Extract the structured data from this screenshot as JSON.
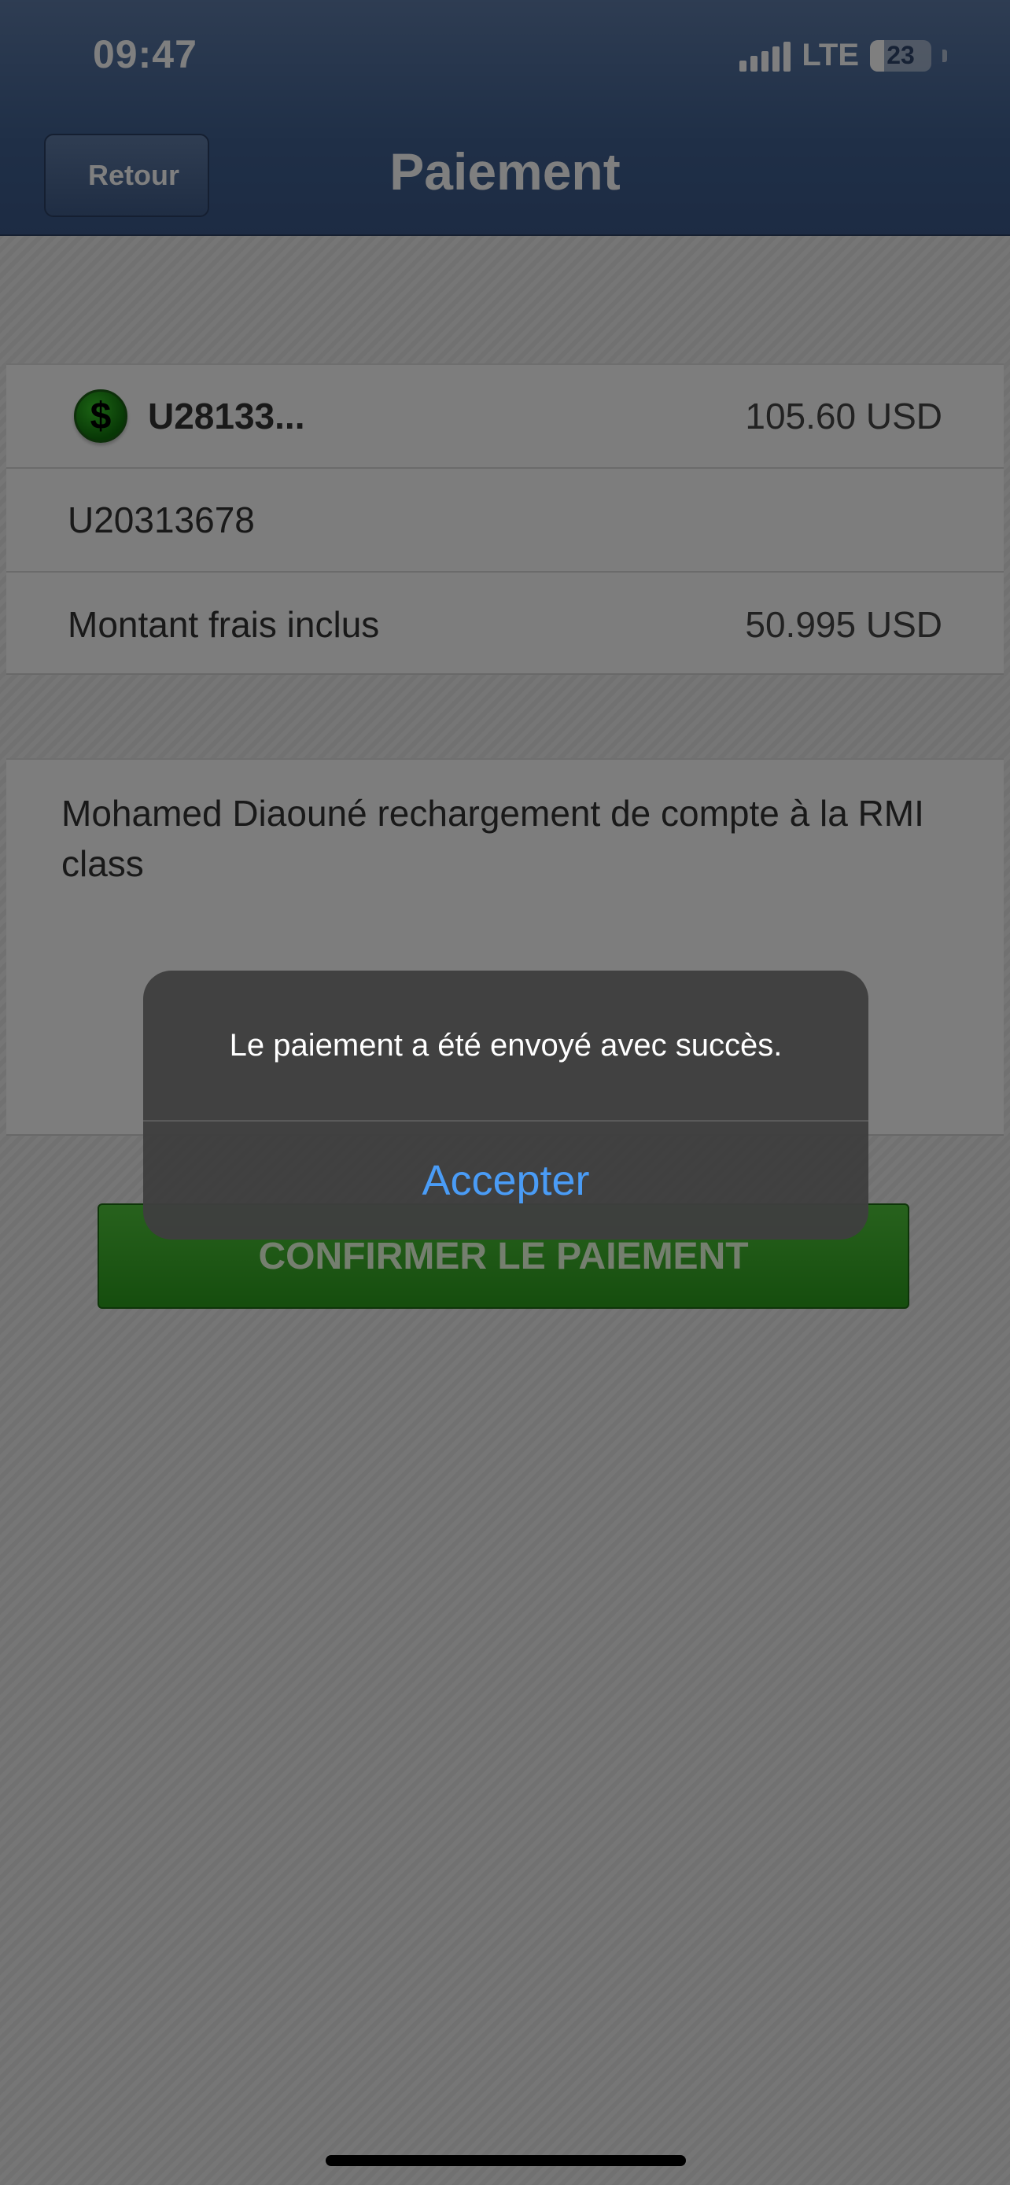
{
  "status_bar": {
    "time": "09:47",
    "network": "LTE",
    "battery_level": "23",
    "battery_fraction": 0.23
  },
  "nav": {
    "back_label": "Retour",
    "title": "Paiement"
  },
  "details": {
    "payer_account": "U28133...",
    "payer_balance": "105.60 USD",
    "payee_account": "U20313678",
    "amount_label": "Montant frais inclus",
    "amount_value": "50.995 USD"
  },
  "memo": "Mohamed Diaouné rechargement de compte à la RMI class",
  "confirm_button": "CONFIRMER LE PAIEMENT",
  "alert": {
    "message": "Le paiement a été envoyé avec succès.",
    "button": "Accepter"
  },
  "colors": {
    "nav_bar": "#3f5f8f",
    "confirm_green": "#2b9b1c",
    "alert_link": "#4a9cf6"
  },
  "icons": [
    "dollar-coin-icon",
    "signal-icon",
    "battery-icon"
  ]
}
